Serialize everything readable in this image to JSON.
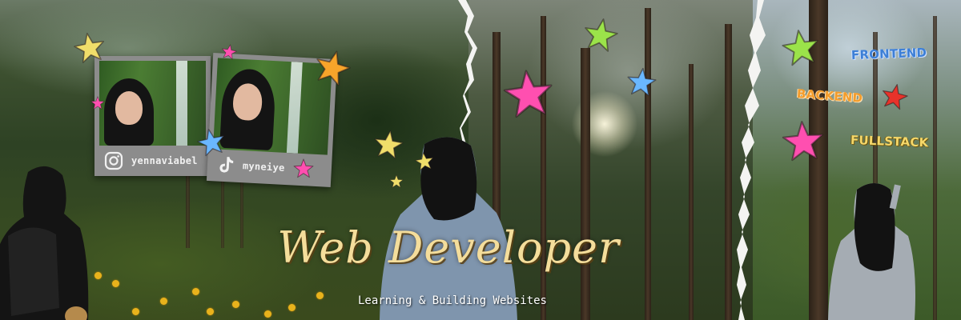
{
  "banner": {
    "title": "Web Developer",
    "subtitle": "Learning & Building Websites"
  },
  "socials": [
    {
      "platform": "instagram",
      "icon": "instagram-icon",
      "handle": "yennaviabel"
    },
    {
      "platform": "tiktok",
      "icon": "tiktok-icon",
      "handle": "myneiye"
    }
  ],
  "tags": {
    "frontend": "FRONTEND",
    "backend": "BACKEND",
    "fullstack": "FULLSTACK"
  },
  "colors": {
    "title": "#f4dd9b",
    "frontend": "#3d7fd6",
    "backend": "#f39c2c",
    "fullstack": "#f5d86a",
    "star_pink": "#ff4fb0",
    "star_yellow": "#f0de6a",
    "star_blue": "#6ab7ff",
    "star_green": "#9be34a",
    "star_red": "#e8322a",
    "star_orange": "#f7a42a"
  }
}
